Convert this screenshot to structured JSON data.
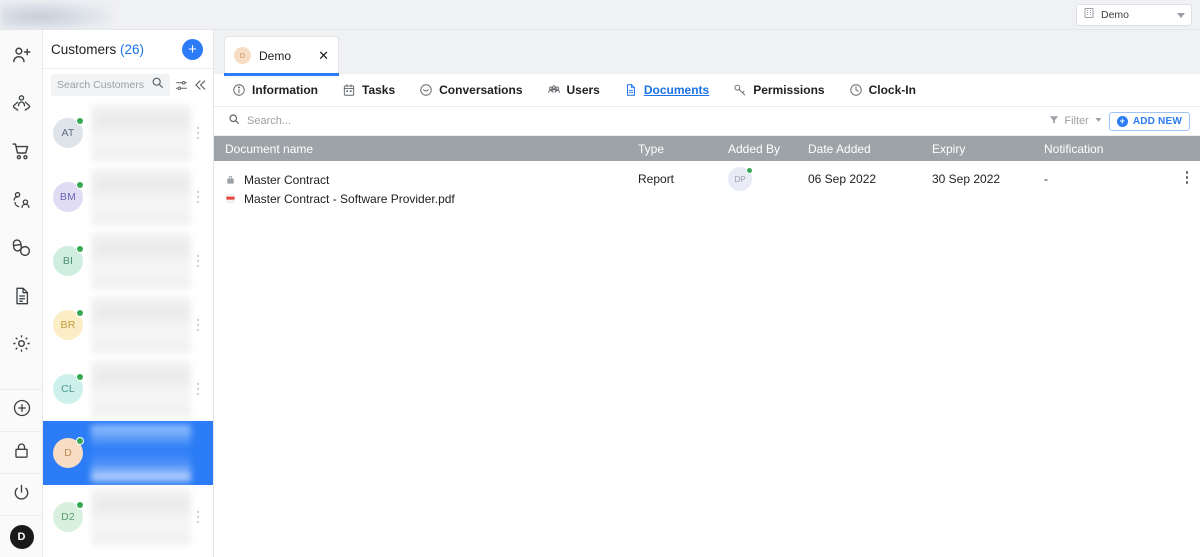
{
  "topbar": {
    "logo_name": "app-logo",
    "org_selector": {
      "label": "Demo",
      "icon": "building-icon"
    }
  },
  "rail": {
    "top_items": [
      {
        "name": "add-user-icon",
        "title": "Add User"
      },
      {
        "name": "care-hands-icon",
        "title": "Care"
      },
      {
        "name": "cart-icon",
        "title": "Orders"
      },
      {
        "name": "user-switch-icon",
        "title": "Contacts"
      },
      {
        "name": "pills-icon",
        "title": "Medication"
      },
      {
        "name": "document-icon",
        "title": "Documents"
      },
      {
        "name": "gear-icon",
        "title": "Settings"
      }
    ],
    "bottom_items": [
      {
        "name": "plus-circle-icon",
        "title": "Add"
      },
      {
        "name": "lock-icon",
        "title": "Lock"
      },
      {
        "name": "power-icon",
        "title": "Sign out"
      }
    ],
    "account_initial": "D"
  },
  "customers": {
    "title": "Customers",
    "count": "(26)",
    "add_button_label": "+",
    "search_placeholder": "Search Customers",
    "search_icon": "search-icon",
    "sort_icon": "sort-filter-icon",
    "collapse_icon": "collapse-left-icon",
    "rows": [
      {
        "initials": "AT",
        "bg": "#dfe3ea",
        "fg": "#5f6f86",
        "selected": false
      },
      {
        "initials": "BM",
        "bg": "#dfdcf4",
        "fg": "#6b66b5",
        "selected": false
      },
      {
        "initials": "BI",
        "bg": "#cfeee0",
        "fg": "#4a8f72",
        "selected": false
      },
      {
        "initials": "BR",
        "bg": "#fbedc6",
        "fg": "#c39b3b",
        "selected": false
      },
      {
        "initials": "CL",
        "bg": "#cdf0ea",
        "fg": "#4e9a92",
        "selected": false
      },
      {
        "initials": "D",
        "bg": "#f7ddc4",
        "fg": "#c08a4f",
        "selected": true
      },
      {
        "initials": "D2",
        "bg": "#d8f0dd",
        "fg": "#5b9c6e",
        "selected": false
      }
    ]
  },
  "workspace": {
    "tab": {
      "initial": "D",
      "label": "Demo",
      "close_label": "✕"
    },
    "nav_tabs": [
      {
        "label": "Information",
        "icon": "info-circle-icon",
        "active": false
      },
      {
        "label": "Tasks",
        "icon": "calendar-icon",
        "active": false
      },
      {
        "label": "Conversations",
        "icon": "chat-bubble-icon",
        "active": false
      },
      {
        "label": "Users",
        "icon": "people-group-icon",
        "active": false
      },
      {
        "label": "Documents",
        "icon": "document-icon",
        "active": true
      },
      {
        "label": "Permissions",
        "icon": "key-icon",
        "active": false
      },
      {
        "label": "Clock-In",
        "icon": "clock-icon",
        "active": false
      }
    ],
    "toolbar": {
      "search_placeholder": "Search...",
      "search_icon": "search-icon",
      "filter_label": "Filter",
      "filter_icon": "funnel-icon",
      "add_new_label": "ADD NEW",
      "add_new_icon": "plus-circle-icon"
    },
    "table": {
      "columns": [
        "Document name",
        "Type",
        "Added By",
        "Date Added",
        "Expiry",
        "Notification"
      ],
      "rows": [
        {
          "document_name": "Master Contract",
          "file_name": "Master Contract - Software Provider.pdf",
          "lock_icon": "lock-icon",
          "file_icon": "pdf-file-icon",
          "type": "Report",
          "added_by_initials": "DP",
          "date_added": "06 Sep 2022",
          "expiry": "30 Sep 2022",
          "notification": "-",
          "menu_icon": "kebab-menu-icon"
        }
      ]
    }
  },
  "colors": {
    "accent": "#2b7cf6",
    "link": "#1a73e8",
    "header_gray": "#9ea3a8",
    "online_green": "#34a853",
    "pdf_red": "#e8453c"
  }
}
